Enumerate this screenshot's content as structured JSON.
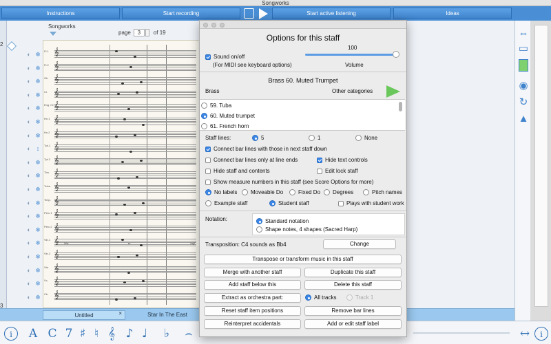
{
  "window": {
    "title": "Songworks"
  },
  "toolbar": {
    "instructions": "Instructions",
    "record": "Start recording",
    "listen": "Start active listening",
    "ideas": "Ideas"
  },
  "score": {
    "title": "Songworks",
    "page_label": "page",
    "page_value": "3",
    "page_total": "of 19",
    "left_number_top": "2",
    "left_number_bottom": "3",
    "staff_labels": [
      "Fl.1",
      "Fl.2",
      "Ob.",
      "Cl.",
      "Eng. Hn.",
      "Hn.1",
      "Hn.2",
      "Tpt.1",
      "Tpt.2",
      "Tbn.",
      "Tuba",
      "Timp.",
      "Perc.1",
      "Perc.2",
      "Vln.1",
      "Vln.2",
      "Vla.",
      "Vc.",
      "Cb."
    ],
    "lyrics": [
      "Wa-",
      "er-",
      "ing!"
    ]
  },
  "tabs": {
    "tab1": "Untitled",
    "tab1_close": "×",
    "tab2": "Star In The East"
  },
  "bottom_icons": [
    "i",
    "A",
    "C",
    "7",
    "♯",
    "♮",
    "𝄞",
    "♪",
    "♩",
    "♭",
    "⌢",
    "↔",
    "i"
  ],
  "dialog": {
    "title": "Options for this staff",
    "sound_label": "Sound on/off",
    "midi_note": "(For MIDI see keyboard options)",
    "volume_value": "100",
    "volume_label": "Volume",
    "instrument_title": "Brass 60. Muted Trumpet",
    "category": "Brass",
    "other_categories": "Other categories",
    "instruments": [
      {
        "label": "59. Tuba",
        "selected": false
      },
      {
        "label": "60. Muted trumpet",
        "selected": true
      },
      {
        "label": "61. French horn",
        "selected": false
      }
    ],
    "staff_lines_label": "Staff lines:",
    "staff_lines_opts": [
      "5",
      "1",
      "None"
    ],
    "connect_bars": "Connect bar lines with those in next staff down",
    "connect_line_ends": "Connect bar lines only at line ends",
    "hide_text_controls": "Hide text controls",
    "hide_staff": "Hide staff and contents",
    "edit_lock": "Edit lock staff",
    "show_measure_numbers": "Show measure numbers in this staff (see Score Options for more)",
    "label_opts": [
      "No labels",
      "Moveable Do",
      "Fixed Do",
      "Degrees",
      "Pitch names"
    ],
    "example_staff": "Example staff",
    "student_staff": "Student staff",
    "plays_with_student": "Plays with student work",
    "notation_label": "Notation:",
    "notation_opts": [
      "Standard notation",
      "Shape notes, 4 shapes (Sacred Harp)"
    ],
    "transposition": "Transposition: C4 sounds as Bb4",
    "change": "Change",
    "transpose_btn": "Transpose or transform music in this staff",
    "merge_btn": "Merge with another staff",
    "duplicate_btn": "Duplicate this staff",
    "add_below_btn": "Add staff below this",
    "delete_btn": "Delete this staff",
    "extract_btn": "Extract as orchestra part:",
    "all_tracks": "All tracks",
    "track1": "Track 1",
    "reset_btn": "Reset staff item positions",
    "remove_bar_btn": "Remove bar lines",
    "reinterpret_btn": "Reinterpret accidentals",
    "add_label_btn": "Add or edit staff label"
  },
  "colors": {
    "toolbar_blue": "#4a8fd6",
    "accent": "#3b86e6",
    "play_green": "#6ac75b"
  }
}
